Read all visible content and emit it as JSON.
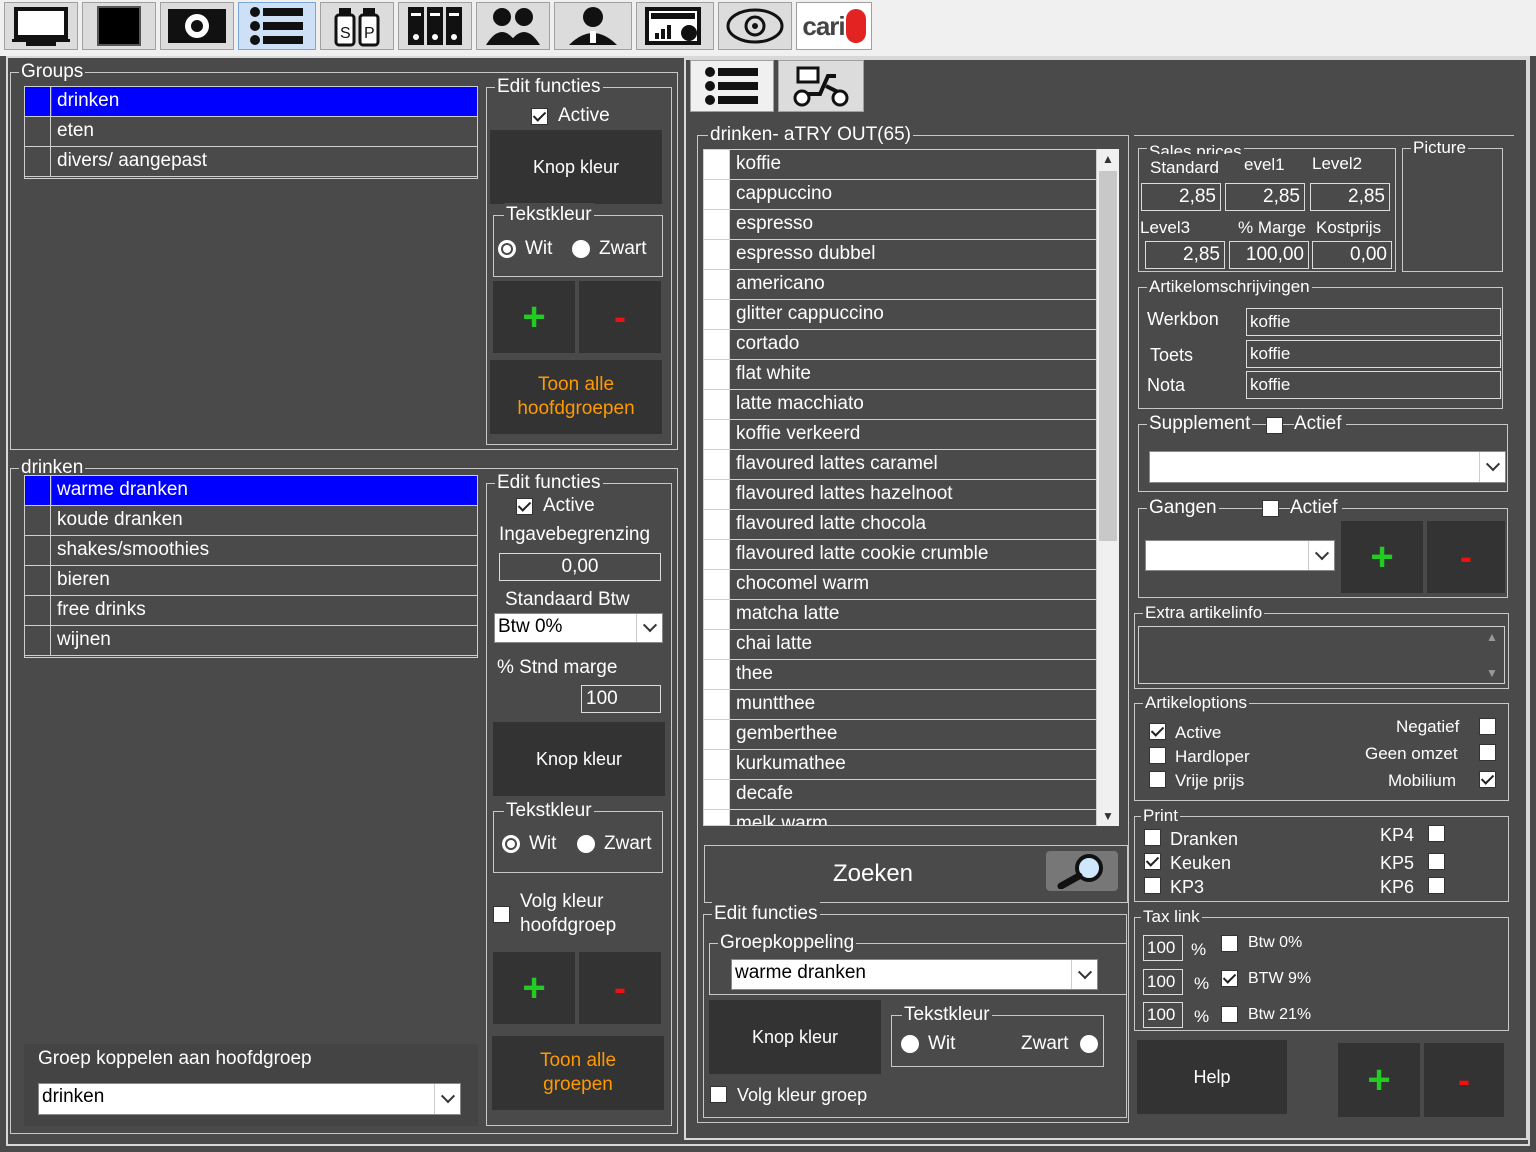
{
  "toolbar": {
    "buttons": [
      {
        "icon": "monitor-icon"
      },
      {
        "icon": "black-screen-icon"
      },
      {
        "icon": "gear-icon"
      },
      {
        "icon": "list-icon"
      },
      {
        "icon": "salt-pepper-icon"
      },
      {
        "icon": "binders-icon"
      },
      {
        "icon": "users-icon"
      },
      {
        "icon": "employee-icon"
      },
      {
        "icon": "report-icon"
      },
      {
        "icon": "eye-icon"
      },
      {
        "icon": "cariam-logo",
        "text": "cari"
      }
    ]
  },
  "groups": {
    "title": "Groups",
    "items": [
      "drinken",
      "eten",
      "divers/ aangepast"
    ],
    "selected": "drinken",
    "edit": {
      "title": "Edit functies",
      "active_label": "Active",
      "knop_kleur": "Knop kleur",
      "tekstkleur_title": "Tekstkleur",
      "wit": "Wit",
      "zwart": "Zwart",
      "plus": "+",
      "minus": "-",
      "toon_alle": "Toon alle hoofdgroepen"
    }
  },
  "subgroups": {
    "title": "drinken",
    "items": [
      "warme dranken",
      "koude dranken",
      "shakes/smoothies",
      "bieren",
      "free drinks",
      "wijnen"
    ],
    "selected": "warme dranken",
    "edit": {
      "title": "Edit functies",
      "active_label": "Active",
      "ingave_label": "Ingavebegrenzing",
      "ingave_value": "0,00",
      "std_btw_label": "Standaard Btw",
      "std_btw_value": "Btw 0%",
      "marge_label": "% Stnd marge",
      "marge_value": "100",
      "knop_kleur": "Knop kleur",
      "tekstkleur_title": "Tekstkleur",
      "wit": "Wit",
      "zwart": "Zwart",
      "volg_kleur": "Volg kleur hoofdgroep",
      "plus": "+",
      "minus": "-",
      "toon_alle": "Toon alle groepen"
    },
    "koppel_label": "Groep koppelen aan hoofdgroep",
    "koppel_value": "drinken"
  },
  "articles": {
    "tabs": [
      {
        "icon": "list-icon"
      },
      {
        "icon": "scooter-icon"
      }
    ],
    "title": "drinken- aTRY OUT(65)",
    "items": [
      "koffie",
      "cappuccino",
      "espresso",
      "espresso dubbel",
      "americano",
      "glitter cappuccino",
      "cortado",
      "flat white",
      "latte macchiato",
      "koffie verkeerd",
      "flavoured lattes caramel",
      "flavoured lattes hazelnoot",
      "flavoured latte chocola",
      "flavoured latte cookie crumble",
      "chocomel warm",
      "matcha latte",
      "chai latte",
      "thee",
      "muntthee",
      "gemberthee",
      "kurkumathee",
      "decafe",
      "melk warm"
    ],
    "zoeken": "Zoeken",
    "edit": {
      "title": "Edit functies",
      "groepkoppeling_title": "Groepkoppeling",
      "groepkoppeling_value": "warme dranken",
      "knop_kleur": "Knop kleur",
      "tekstkleur_title": "Tekstkleur",
      "wit": "Wit",
      "zwart": "Zwart",
      "volg_kleur": "Volg kleur groep"
    }
  },
  "details": {
    "sales_prices": {
      "title": "Sales prices",
      "standard_label": "Standard",
      "level1_label": "evel1",
      "level2_label": "Level2",
      "level3_label": "Level3",
      "marge_label": "% Marge",
      "kostprijs_label": "Kostprijs",
      "standard": "2,85",
      "level1": "2,85",
      "level2": "2,85",
      "level3": "2,85",
      "marge": "100,00",
      "kostprijs": "0,00"
    },
    "picture_title": "Picture",
    "omschrijvingen": {
      "title": "Artikelomschrijvingen",
      "werkbon_label": "Werkbon",
      "werkbon": "koffie",
      "toets_label": "Toets",
      "toets": "koffie",
      "nota_label": "Nota",
      "nota": "koffie"
    },
    "supplement": {
      "title": "Supplement",
      "actief": "Actief",
      "value": ""
    },
    "gangen": {
      "title": "Gangen",
      "actief": "Actief",
      "value": "",
      "plus": "+",
      "minus": "-"
    },
    "extra_info_title": "Extra artikelinfo",
    "artikeloptions": {
      "title": "Artikeloptions",
      "active": "Active",
      "hardloper": "Hardloper",
      "vrije_prijs": "Vrije prijs",
      "negatief": "Negatief",
      "geen_omzet": "Geen omzet",
      "mobilium": "Mobilium"
    },
    "print": {
      "title": "Print",
      "dranken": "Dranken",
      "keuken": "Keuken",
      "kp3": "KP3",
      "kp4": "KP4",
      "kp5": "KP5",
      "kp6": "KP6"
    },
    "tax": {
      "title": "Tax link",
      "rows": [
        {
          "value": "100",
          "pct": "%",
          "label": "Btw 0%"
        },
        {
          "value": "100",
          "pct": "%",
          "label": "BTW 9%"
        },
        {
          "value": "100",
          "pct": "%",
          "label": "Btw 21%"
        }
      ]
    },
    "help": "Help",
    "plus": "+",
    "minus": "-"
  }
}
